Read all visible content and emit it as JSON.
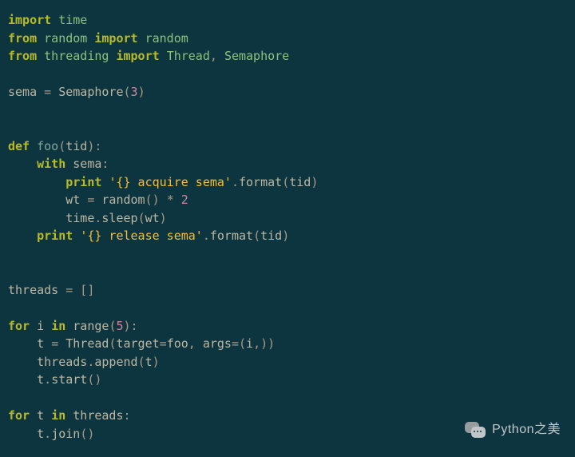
{
  "code": {
    "tokens": [
      [
        {
          "c": "kw",
          "t": "import"
        },
        {
          "c": "",
          "t": " "
        },
        {
          "c": "mod",
          "t": "time"
        }
      ],
      [
        {
          "c": "kw",
          "t": "from"
        },
        {
          "c": "",
          "t": " "
        },
        {
          "c": "mod",
          "t": "random"
        },
        {
          "c": "",
          "t": " "
        },
        {
          "c": "kw",
          "t": "import"
        },
        {
          "c": "",
          "t": " "
        },
        {
          "c": "mod",
          "t": "random"
        }
      ],
      [
        {
          "c": "kw",
          "t": "from"
        },
        {
          "c": "",
          "t": " "
        },
        {
          "c": "mod",
          "t": "threading"
        },
        {
          "c": "",
          "t": " "
        },
        {
          "c": "kw",
          "t": "import"
        },
        {
          "c": "",
          "t": " "
        },
        {
          "c": "mod",
          "t": "Thread"
        },
        {
          "c": "punc",
          "t": ", "
        },
        {
          "c": "mod",
          "t": "Semaphore"
        }
      ],
      [],
      [
        {
          "c": "id",
          "t": "sema "
        },
        {
          "c": "punc",
          "t": "= "
        },
        {
          "c": "id",
          "t": "Semaphore"
        },
        {
          "c": "punc",
          "t": "("
        },
        {
          "c": "num",
          "t": "3"
        },
        {
          "c": "punc",
          "t": ")"
        }
      ],
      [],
      [],
      [
        {
          "c": "kw",
          "t": "def"
        },
        {
          "c": "",
          "t": " "
        },
        {
          "c": "fn",
          "t": "foo"
        },
        {
          "c": "punc",
          "t": "("
        },
        {
          "c": "id",
          "t": "tid"
        },
        {
          "c": "punc",
          "t": "):"
        }
      ],
      [
        {
          "c": "",
          "t": "    "
        },
        {
          "c": "kw",
          "t": "with"
        },
        {
          "c": "",
          "t": " "
        },
        {
          "c": "id",
          "t": "sema"
        },
        {
          "c": "punc",
          "t": ":"
        }
      ],
      [
        {
          "c": "",
          "t": "        "
        },
        {
          "c": "print",
          "t": "print"
        },
        {
          "c": "",
          "t": " "
        },
        {
          "c": "str",
          "t": "'{} acquire sema'"
        },
        {
          "c": "punc",
          "t": "."
        },
        {
          "c": "id",
          "t": "format"
        },
        {
          "c": "punc",
          "t": "("
        },
        {
          "c": "id",
          "t": "tid"
        },
        {
          "c": "punc",
          "t": ")"
        }
      ],
      [
        {
          "c": "",
          "t": "        "
        },
        {
          "c": "id",
          "t": "wt "
        },
        {
          "c": "punc",
          "t": "= "
        },
        {
          "c": "id",
          "t": "random"
        },
        {
          "c": "punc",
          "t": "() "
        },
        {
          "c": "punc",
          "t": "* "
        },
        {
          "c": "num",
          "t": "2"
        }
      ],
      [
        {
          "c": "",
          "t": "        "
        },
        {
          "c": "id",
          "t": "time"
        },
        {
          "c": "punc",
          "t": "."
        },
        {
          "c": "id",
          "t": "sleep"
        },
        {
          "c": "punc",
          "t": "("
        },
        {
          "c": "id",
          "t": "wt"
        },
        {
          "c": "punc",
          "t": ")"
        }
      ],
      [
        {
          "c": "",
          "t": "    "
        },
        {
          "c": "print",
          "t": "print"
        },
        {
          "c": "",
          "t": " "
        },
        {
          "c": "str",
          "t": "'{} release sema'"
        },
        {
          "c": "punc",
          "t": "."
        },
        {
          "c": "id",
          "t": "format"
        },
        {
          "c": "punc",
          "t": "("
        },
        {
          "c": "id",
          "t": "tid"
        },
        {
          "c": "punc",
          "t": ")"
        }
      ],
      [],
      [],
      [
        {
          "c": "id",
          "t": "threads "
        },
        {
          "c": "punc",
          "t": "= []"
        }
      ],
      [],
      [
        {
          "c": "kw",
          "t": "for"
        },
        {
          "c": "",
          "t": " "
        },
        {
          "c": "id",
          "t": "i"
        },
        {
          "c": "",
          "t": " "
        },
        {
          "c": "kw",
          "t": "in"
        },
        {
          "c": "",
          "t": " "
        },
        {
          "c": "id",
          "t": "range"
        },
        {
          "c": "punc",
          "t": "("
        },
        {
          "c": "num",
          "t": "5"
        },
        {
          "c": "punc",
          "t": "):"
        }
      ],
      [
        {
          "c": "",
          "t": "    "
        },
        {
          "c": "id",
          "t": "t "
        },
        {
          "c": "punc",
          "t": "= "
        },
        {
          "c": "id",
          "t": "Thread"
        },
        {
          "c": "punc",
          "t": "("
        },
        {
          "c": "id",
          "t": "target"
        },
        {
          "c": "punc",
          "t": "="
        },
        {
          "c": "id",
          "t": "foo"
        },
        {
          "c": "punc",
          "t": ", "
        },
        {
          "c": "id",
          "t": "args"
        },
        {
          "c": "punc",
          "t": "=("
        },
        {
          "c": "id",
          "t": "i"
        },
        {
          "c": "punc",
          "t": ",))"
        }
      ],
      [
        {
          "c": "",
          "t": "    "
        },
        {
          "c": "id",
          "t": "threads"
        },
        {
          "c": "punc",
          "t": "."
        },
        {
          "c": "id",
          "t": "append"
        },
        {
          "c": "punc",
          "t": "("
        },
        {
          "c": "id",
          "t": "t"
        },
        {
          "c": "punc",
          "t": ")"
        }
      ],
      [
        {
          "c": "",
          "t": "    "
        },
        {
          "c": "id",
          "t": "t"
        },
        {
          "c": "punc",
          "t": "."
        },
        {
          "c": "id",
          "t": "start"
        },
        {
          "c": "punc",
          "t": "()"
        }
      ],
      [],
      [
        {
          "c": "kw",
          "t": "for"
        },
        {
          "c": "",
          "t": " "
        },
        {
          "c": "id",
          "t": "t"
        },
        {
          "c": "",
          "t": " "
        },
        {
          "c": "kw",
          "t": "in"
        },
        {
          "c": "",
          "t": " "
        },
        {
          "c": "id",
          "t": "threads"
        },
        {
          "c": "punc",
          "t": ":"
        }
      ],
      [
        {
          "c": "",
          "t": "    "
        },
        {
          "c": "id",
          "t": "t"
        },
        {
          "c": "punc",
          "t": "."
        },
        {
          "c": "id",
          "t": "join"
        },
        {
          "c": "punc",
          "t": "()"
        }
      ]
    ]
  },
  "watermark": {
    "label": "Python之美"
  }
}
